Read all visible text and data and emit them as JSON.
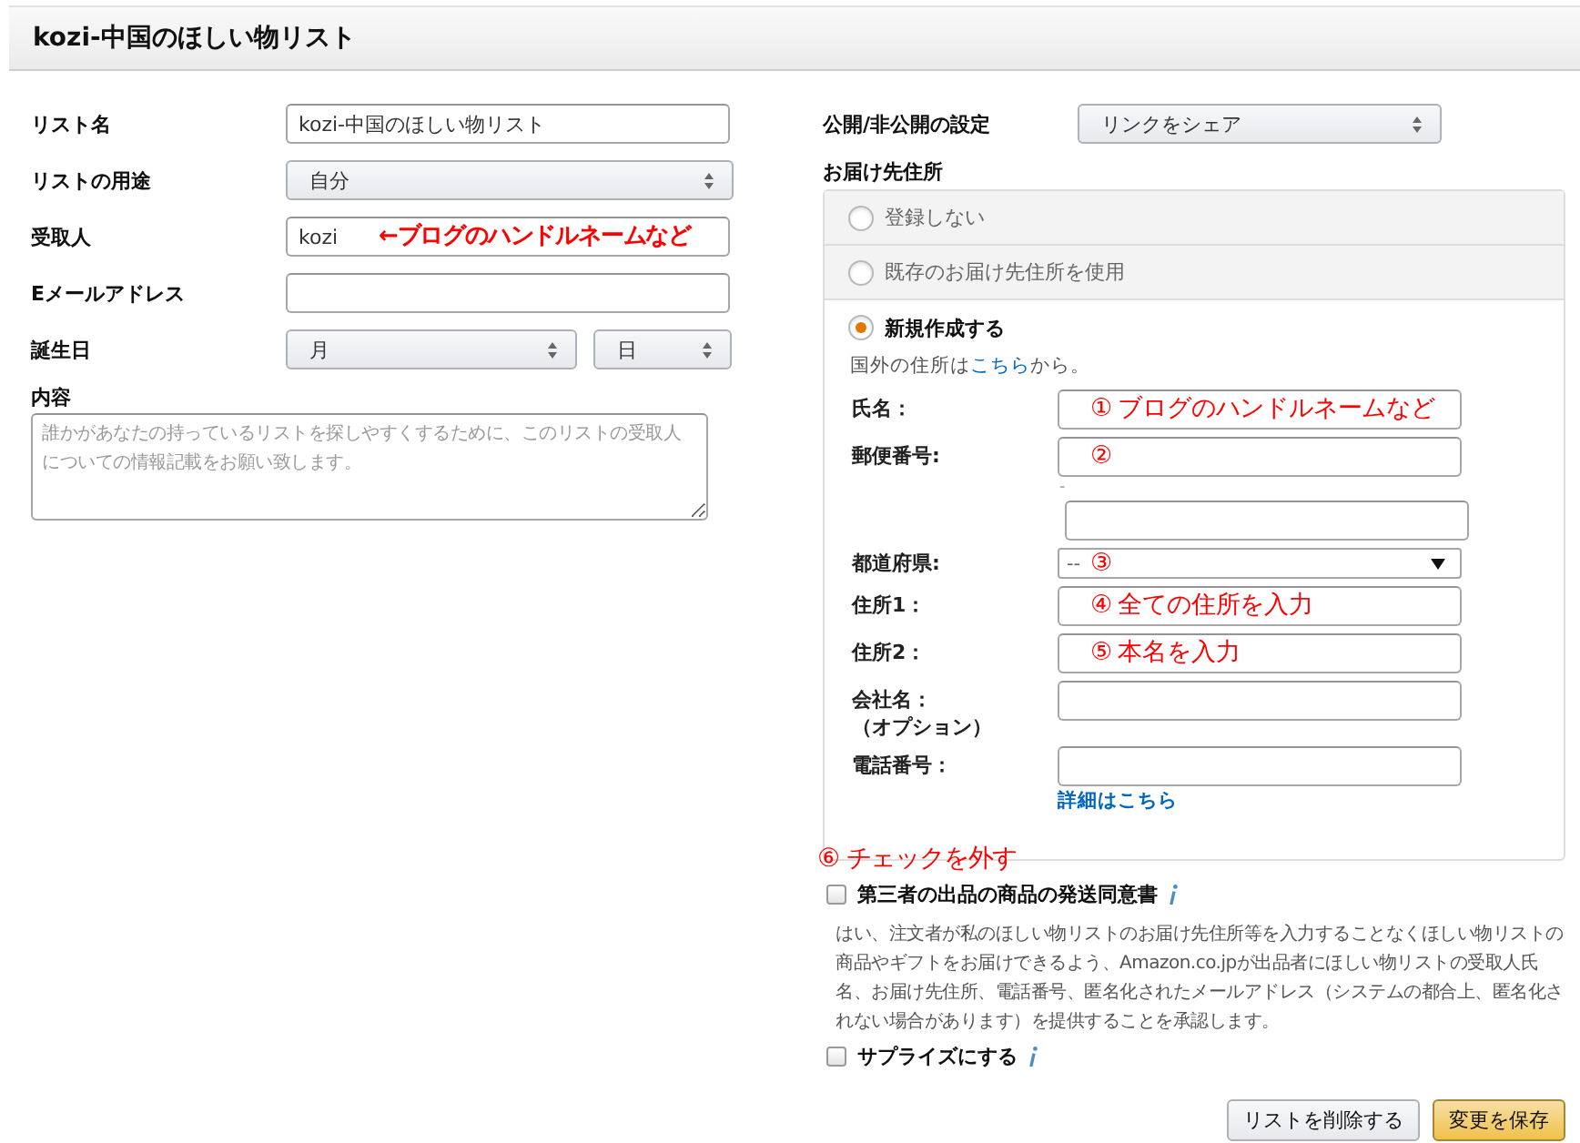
{
  "header": {
    "title": "kozi-中国のほしい物リスト"
  },
  "list_form": {
    "fields": [
      {
        "kind": "input",
        "label": "リスト名",
        "value": "kozi-中国のほしい物リスト"
      },
      {
        "kind": "select",
        "label": "リストの用途",
        "value": "自分"
      },
      {
        "kind": "input",
        "label": "受取人",
        "value": "kozi",
        "annotation": "←ブログのハンドルネームなど"
      },
      {
        "kind": "input",
        "label": "Eメールアドレス"
      },
      {
        "kind": "date",
        "label": "誕生日",
        "month": "月",
        "day": "日"
      }
    ],
    "description": {
      "label": "内容",
      "placeholder": "誰かがあなたの持っているリストを探しやすくするために、このリストの受取人についての情報記載をお願い致します。"
    }
  },
  "privacy": {
    "label": "公開/非公開の設定",
    "value": "リンクをシェア"
  },
  "shipping_address": {
    "label": "お届け先住所",
    "options": [
      {
        "label": "登録しない",
        "selected": false
      },
      {
        "label": "既存のお届け先住所を使用",
        "selected": false
      },
      {
        "label": "新規作成する",
        "selected": true
      }
    ],
    "overseas_note": {
      "text": "国外の住所は",
      "link": "こちら",
      "text_after": "から。"
    },
    "fields": [
      {
        "kind": "input",
        "label": "氏名：",
        "annotation": "① ブログのハンドルネームなど"
      },
      {
        "kind": "postal",
        "label": "郵便番号:",
        "annotation": "②",
        "separator": "-"
      },
      {
        "kind": "select",
        "label": "都道府県:",
        "value": "--",
        "annotation": "③"
      },
      {
        "kind": "input",
        "label": "住所1：",
        "annotation": "④ 全ての住所を入力"
      },
      {
        "kind": "input",
        "label": "住所2：",
        "annotation": "⑤ 本名を入力"
      },
      {
        "kind": "input",
        "label": "会社名：",
        "sublabel": "（オプション）"
      },
      {
        "kind": "input",
        "label": "電話番号：",
        "link": "詳細はこちら"
      }
    ],
    "annotation": "⑥ チェックを外す"
  },
  "consents": [
    {
      "label": "第三者の出品の商品の発送同意書",
      "checked": false,
      "description": "はい、注文者が私のほしい物リストのお届け先住所等を入力することなくほしい物リストの商品やギフトをお届けできるよう、Amazon.co.jpが出品者にほしい物リストの受取人氏名、お届け先住所、電話番号、匿名化されたメールアドレス（システムの都合上、匿名化されない場合があります）を提供することを承認します。"
    },
    {
      "label": "サプライズにする",
      "checked": false
    }
  ],
  "buttons": [
    {
      "label": "リストを削除する",
      "kind": "secondary"
    },
    {
      "label": "変更を保存",
      "kind": "primary"
    }
  ]
}
